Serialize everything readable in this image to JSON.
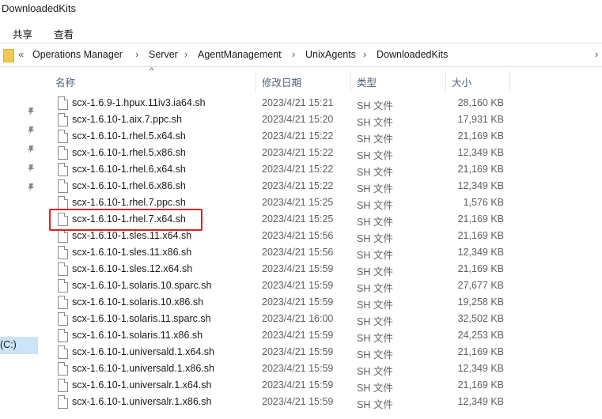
{
  "window": {
    "title": "DownloadedKits"
  },
  "ribbon": {
    "share": "共享",
    "view": "查看"
  },
  "address": {
    "prefix": "«",
    "parts": [
      "Operations Manager",
      "Server",
      "AgentManagement",
      "UnixAgents",
      "DownloadedKits"
    ]
  },
  "nav": {
    "drive_label": "(C:)"
  },
  "columns": {
    "name": "名称",
    "date": "修改日期",
    "type": "类型",
    "size": "大小"
  },
  "files": [
    {
      "name": "scx-1.6.9-1.hpux.11iv3.ia64.sh",
      "date": "2023/4/21 15:21",
      "type": "SH 文件",
      "size": "28,160 KB"
    },
    {
      "name": "scx-1.6.10-1.aix.7.ppc.sh",
      "date": "2023/4/21 15:20",
      "type": "SH 文件",
      "size": "17,931 KB"
    },
    {
      "name": "scx-1.6.10-1.rhel.5.x64.sh",
      "date": "2023/4/21 15:22",
      "type": "SH 文件",
      "size": "21,169 KB"
    },
    {
      "name": "scx-1.6.10-1.rhel.5.x86.sh",
      "date": "2023/4/21 15:22",
      "type": "SH 文件",
      "size": "12,349 KB"
    },
    {
      "name": "scx-1.6.10-1.rhel.6.x64.sh",
      "date": "2023/4/21 15:22",
      "type": "SH 文件",
      "size": "21,169 KB"
    },
    {
      "name": "scx-1.6.10-1.rhel.6.x86.sh",
      "date": "2023/4/21 15:22",
      "type": "SH 文件",
      "size": "12,349 KB"
    },
    {
      "name": "scx-1.6.10-1.rhel.7.ppc.sh",
      "date": "2023/4/21 15:25",
      "type": "SH 文件",
      "size": "1,576 KB"
    },
    {
      "name": "scx-1.6.10-1.rhel.7.x64.sh",
      "date": "2023/4/21 15:25",
      "type": "SH 文件",
      "size": "21,169 KB"
    },
    {
      "name": "scx-1.6.10-1.sles.11.x64.sh",
      "date": "2023/4/21 15:56",
      "type": "SH 文件",
      "size": "21,169 KB"
    },
    {
      "name": "scx-1.6.10-1.sles.11.x86.sh",
      "date": "2023/4/21 15:56",
      "type": "SH 文件",
      "size": "12,349 KB"
    },
    {
      "name": "scx-1.6.10-1.sles.12.x64.sh",
      "date": "2023/4/21 15:59",
      "type": "SH 文件",
      "size": "21,169 KB"
    },
    {
      "name": "scx-1.6.10-1.solaris.10.sparc.sh",
      "date": "2023/4/21 15:59",
      "type": "SH 文件",
      "size": "27,677 KB"
    },
    {
      "name": "scx-1.6.10-1.solaris.10.x86.sh",
      "date": "2023/4/21 15:59",
      "type": "SH 文件",
      "size": "19,258 KB"
    },
    {
      "name": "scx-1.6.10-1.solaris.11.sparc.sh",
      "date": "2023/4/21 16:00",
      "type": "SH 文件",
      "size": "32,502 KB"
    },
    {
      "name": "scx-1.6.10-1.solaris.11.x86.sh",
      "date": "2023/4/21 15:59",
      "type": "SH 文件",
      "size": "24,253 KB"
    },
    {
      "name": "scx-1.6.10-1.universald.1.x64.sh",
      "date": "2023/4/21 15:59",
      "type": "SH 文件",
      "size": "21,169 KB"
    },
    {
      "name": "scx-1.6.10-1.universald.1.x86.sh",
      "date": "2023/4/21 15:59",
      "type": "SH 文件",
      "size": "12,349 KB"
    },
    {
      "name": "scx-1.6.10-1.universalr.1.x64.sh",
      "date": "2023/4/21 15:59",
      "type": "SH 文件",
      "size": "21,169 KB"
    },
    {
      "name": "scx-1.6.10-1.universalr.1.x86.sh",
      "date": "2023/4/21 15:59",
      "type": "SH 文件",
      "size": "12,349 KB"
    }
  ],
  "highlighted_file": "scx-1.6.10-1.rhel.7.x64.sh",
  "colors": {
    "highlight_border": "#e02020",
    "selection": "#cce4f7",
    "header_text": "#4c607a"
  }
}
